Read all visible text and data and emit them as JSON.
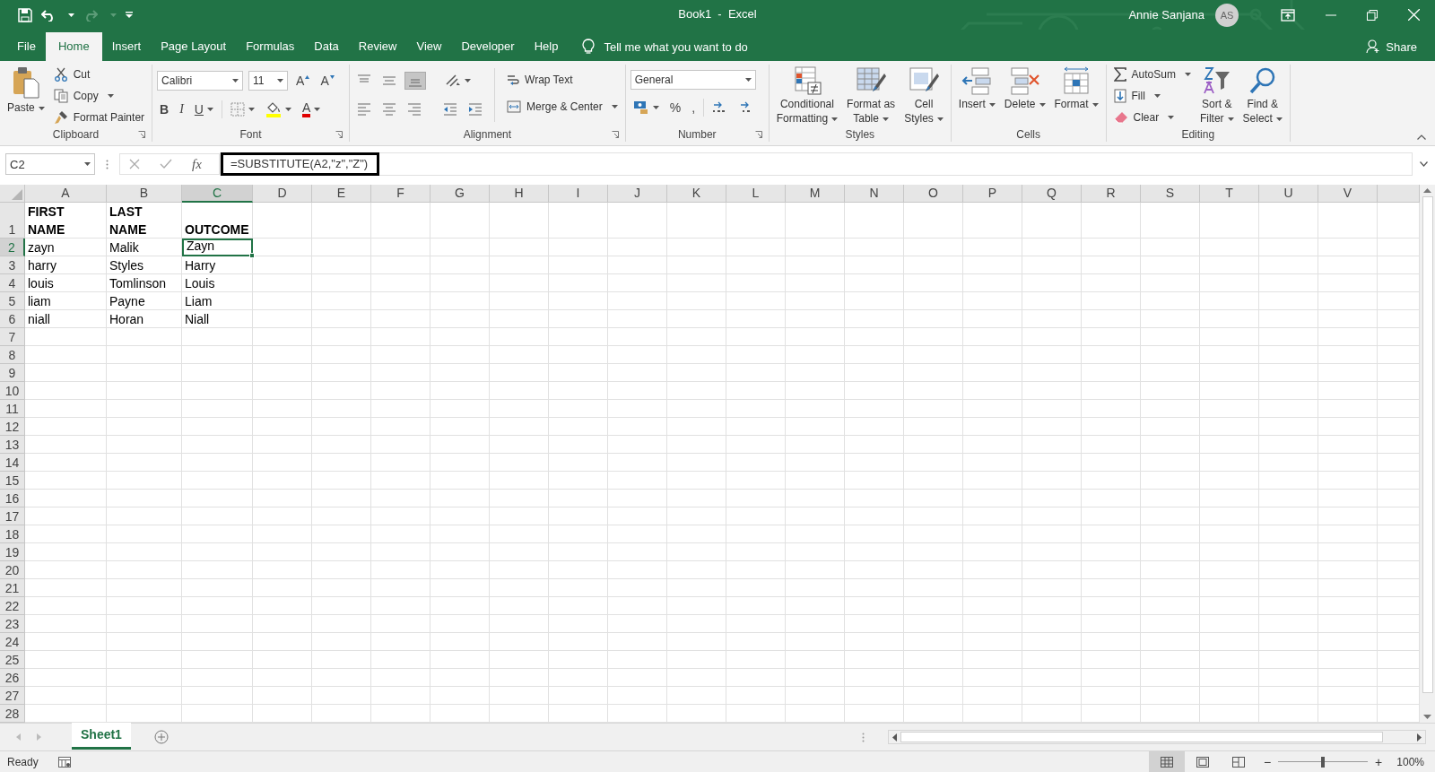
{
  "title_bar": {
    "title": "Book1  -  Excel",
    "user": "Annie Sanjana",
    "avatar": "AS"
  },
  "menu_tabs": [
    {
      "label": "File",
      "selected": false
    },
    {
      "label": "Home",
      "selected": true
    },
    {
      "label": "Insert",
      "selected": false
    },
    {
      "label": "Page Layout",
      "selected": false
    },
    {
      "label": "Formulas",
      "selected": false
    },
    {
      "label": "Data",
      "selected": false
    },
    {
      "label": "Review",
      "selected": false
    },
    {
      "label": "View",
      "selected": false
    },
    {
      "label": "Developer",
      "selected": false
    },
    {
      "label": "Help",
      "selected": false
    }
  ],
  "tell_me": "Tell me what you want to do",
  "share": "Share",
  "ribbon_groups": [
    {
      "kind": "clipboard",
      "label": "Clipboard",
      "launcher": true,
      "items": [
        {
          "kind": "paste",
          "label": "Paste",
          "dropdown": true
        },
        {
          "kind": "cut",
          "label": "Cut"
        },
        {
          "kind": "copy",
          "label": "Copy",
          "dropdown": true
        },
        {
          "kind": "format_painter",
          "label": "Format Painter"
        }
      ]
    },
    {
      "kind": "font",
      "label": "Font",
      "launcher": true,
      "font_name": "Calibri",
      "font_size": "11",
      "items": [
        {
          "kind": "grow",
          "text": "A"
        },
        {
          "kind": "shrink",
          "text": "A"
        },
        {
          "kind": "bold",
          "text": "B"
        },
        {
          "kind": "italic",
          "text": "I"
        },
        {
          "kind": "underline",
          "text": "U",
          "dropdown": true
        },
        {
          "kind": "borders",
          "dropdown": true
        },
        {
          "kind": "fill_color",
          "dropdown": true
        },
        {
          "kind": "font_color",
          "text": "A",
          "dropdown": true
        }
      ]
    },
    {
      "kind": "alignment",
      "label": "Alignment",
      "launcher": true,
      "items": [
        {
          "kind": "top_align",
          "selected": false
        },
        {
          "kind": "middle_align",
          "selected": false
        },
        {
          "kind": "bottom_align",
          "selected": true
        },
        {
          "kind": "orientation",
          "dropdown": true
        },
        {
          "kind": "left_align",
          "selected": false
        },
        {
          "kind": "center_align",
          "selected": false
        },
        {
          "kind": "right_align",
          "selected": false
        },
        {
          "kind": "decrease_indent"
        },
        {
          "kind": "increase_indent"
        },
        {
          "kind": "wrap_text",
          "label": "Wrap Text"
        },
        {
          "kind": "merge_center",
          "label": "Merge & Center",
          "dropdown": true
        }
      ]
    },
    {
      "kind": "number",
      "label": "Number",
      "launcher": true,
      "format": "General",
      "items": [
        {
          "kind": "accounting",
          "dropdown": true
        },
        {
          "kind": "percent",
          "text": "%"
        },
        {
          "kind": "comma",
          "text": ","
        },
        {
          "kind": "increase_decimal"
        },
        {
          "kind": "decrease_decimal"
        }
      ]
    },
    {
      "kind": "styles",
      "label": "Styles",
      "launcher": false,
      "items": [
        {
          "kind": "conditional_formatting",
          "label": "Conditional\nFormatting",
          "dropdown": true
        },
        {
          "kind": "format_table",
          "label": "Format as\nTable",
          "dropdown": true
        },
        {
          "kind": "cell_styles",
          "label": "Cell\nStyles",
          "dropdown": true
        }
      ]
    },
    {
      "kind": "cells",
      "label": "Cells",
      "launcher": false,
      "items": [
        {
          "kind": "insert",
          "label": "Insert",
          "dropdown": true
        },
        {
          "kind": "delete",
          "label": "Delete",
          "dropdown": true
        },
        {
          "kind": "format",
          "label": "Format",
          "dropdown": true
        }
      ]
    },
    {
      "kind": "editing",
      "label": "Editing",
      "launcher": false,
      "items": [
        {
          "kind": "autosum",
          "label": "AutoSum",
          "dropdown": true
        },
        {
          "kind": "fill",
          "label": "Fill",
          "dropdown": true
        },
        {
          "kind": "clear",
          "label": "Clear",
          "dropdown": true
        },
        {
          "kind": "sort_filter",
          "label": "Sort &\nFilter",
          "dropdown": true
        },
        {
          "kind": "find_select",
          "label": "Find &\nSelect",
          "dropdown": true
        }
      ]
    }
  ],
  "name_box": "C2",
  "insert_function": "fx",
  "formula": "=SUBSTITUTE(A2,\"z\",\"Z\")",
  "columns": [
    {
      "label": "A",
      "selected": false
    },
    {
      "label": "B",
      "selected": false
    },
    {
      "label": "C",
      "selected": true
    },
    {
      "label": "D",
      "selected": false
    },
    {
      "label": "E",
      "selected": false
    },
    {
      "label": "F",
      "selected": false
    },
    {
      "label": "G",
      "selected": false
    },
    {
      "label": "H",
      "selected": false
    },
    {
      "label": "I",
      "selected": false
    },
    {
      "label": "J",
      "selected": false
    },
    {
      "label": "K",
      "selected": false
    },
    {
      "label": "L",
      "selected": false
    },
    {
      "label": "M",
      "selected": false
    },
    {
      "label": "N",
      "selected": false
    },
    {
      "label": "O",
      "selected": false
    },
    {
      "label": "P",
      "selected": false
    },
    {
      "label": "Q",
      "selected": false
    },
    {
      "label": "R",
      "selected": false
    },
    {
      "label": "S",
      "selected": false
    },
    {
      "label": "T",
      "selected": false
    },
    {
      "label": "U",
      "selected": false
    },
    {
      "label": "V",
      "selected": false
    }
  ],
  "rows": [
    {
      "header": "1",
      "selected": false,
      "bold": true,
      "cells": [
        {
          "text": "FIRST\nNAME",
          "selected": false
        },
        {
          "text": "LAST\nNAME",
          "selected": false
        },
        {
          "text": "OUTCOME",
          "selected": false
        }
      ]
    },
    {
      "header": "2",
      "selected": true,
      "bold": false,
      "cells": [
        {
          "text": "zayn",
          "selected": false
        },
        {
          "text": "Malik",
          "selected": false
        },
        {
          "text": "Zayn",
          "selected": true
        }
      ]
    },
    {
      "header": "3",
      "selected": false,
      "bold": false,
      "cells": [
        {
          "text": "harry",
          "selected": false
        },
        {
          "text": "Styles",
          "selected": false
        },
        {
          "text": "Harry",
          "selected": false
        }
      ]
    },
    {
      "header": "4",
      "selected": false,
      "bold": false,
      "cells": [
        {
          "text": "louis",
          "selected": false
        },
        {
          "text": "Tomlinson",
          "selected": false
        },
        {
          "text": "Louis",
          "selected": false
        }
      ]
    },
    {
      "header": "5",
      "selected": false,
      "bold": false,
      "cells": [
        {
          "text": "liam",
          "selected": false
        },
        {
          "text": "Payne",
          "selected": false
        },
        {
          "text": "Liam",
          "selected": false
        }
      ]
    },
    {
      "header": "6",
      "selected": false,
      "bold": false,
      "cells": [
        {
          "text": "niall",
          "selected": false
        },
        {
          "text": "Horan",
          "selected": false
        },
        {
          "text": "Niall",
          "selected": false
        }
      ]
    },
    {
      "header": "7",
      "selected": false
    },
    {
      "header": "8",
      "selected": false
    },
    {
      "header": "9",
      "selected": false
    },
    {
      "header": "10",
      "selected": false
    },
    {
      "header": "11",
      "selected": false
    },
    {
      "header": "12",
      "selected": false
    },
    {
      "header": "13",
      "selected": false
    },
    {
      "header": "14",
      "selected": false
    },
    {
      "header": "15",
      "selected": false
    },
    {
      "header": "16",
      "selected": false
    },
    {
      "header": "17",
      "selected": false
    },
    {
      "header": "18",
      "selected": false
    },
    {
      "header": "19",
      "selected": false
    },
    {
      "header": "20",
      "selected": false
    },
    {
      "header": "21",
      "selected": false
    },
    {
      "header": "22",
      "selected": false
    },
    {
      "header": "23",
      "selected": false
    },
    {
      "header": "24",
      "selected": false
    },
    {
      "header": "25",
      "selected": false
    },
    {
      "header": "26",
      "selected": false
    },
    {
      "header": "27",
      "selected": false
    },
    {
      "header": "28",
      "selected": false
    }
  ],
  "sheets": [
    {
      "label": "Sheet1",
      "selected": true
    }
  ],
  "status_bar": {
    "status": "Ready",
    "views": [
      {
        "kind": "normal",
        "selected": true
      },
      {
        "kind": "page_layout",
        "selected": false
      },
      {
        "kind": "page_break",
        "selected": false
      }
    ],
    "zoom_out": "−",
    "zoom_in": "+",
    "zoom": {
      "level": 0.5
    },
    "zoom_text": "100%"
  }
}
